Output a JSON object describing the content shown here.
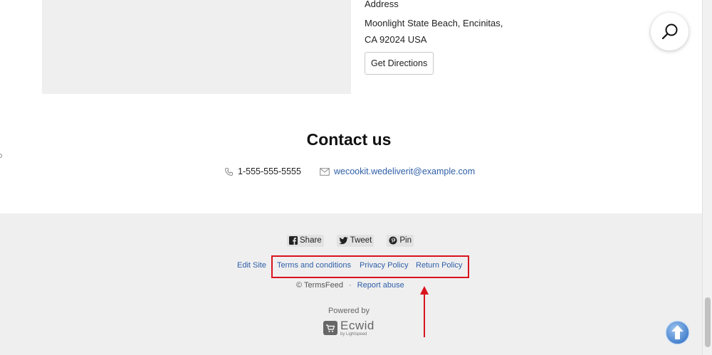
{
  "address": {
    "heading": "Address",
    "line1": "Moonlight State Beach, Encinitas,",
    "line2": "CA 92024 USA",
    "directions_label": "Get Directions"
  },
  "contact": {
    "title": "Contact us",
    "phone": "1-555-555-5555",
    "email": "wecookit.wedeliverit@example.com"
  },
  "footer": {
    "share_buttons": [
      {
        "label": "Share",
        "icon": "facebook-icon"
      },
      {
        "label": "Tweet",
        "icon": "twitter-icon"
      },
      {
        "label": "Pin",
        "icon": "pinterest-icon"
      }
    ],
    "links": {
      "edit_site": "Edit Site",
      "terms": "Terms and conditions",
      "privacy": "Privacy Policy",
      "return_policy": "Return Policy"
    },
    "copyright": "© TermsFeed",
    "separator": "·",
    "report_abuse": "Report abuse",
    "powered_by": "Powered by",
    "ecwid_name": "Ecwid",
    "ecwid_sub": "by Lightspeed"
  },
  "colors": {
    "link": "#2e5ea8",
    "highlight": "#d9141e",
    "footer_bg": "#efefef"
  }
}
